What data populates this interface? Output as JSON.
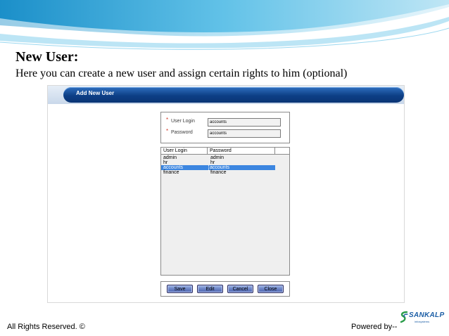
{
  "slide": {
    "title": "New User:",
    "subtitle": "Here you can create a new user and assign certain rights to him (optional)"
  },
  "window": {
    "title": "Add New User"
  },
  "form": {
    "required_mark": "*",
    "user_login_label": "User Login",
    "user_login_value": "accounts",
    "password_label": "Password",
    "password_value": "accounts"
  },
  "user_list": {
    "columns": [
      "User Login",
      "Password"
    ],
    "rows": [
      {
        "login": "admin",
        "password": "admin",
        "selected": false
      },
      {
        "login": "hr",
        "password": "hr",
        "selected": false
      },
      {
        "login": "accounts",
        "password": "accounts",
        "selected": true
      },
      {
        "login": "finance",
        "password": "finance",
        "selected": false
      }
    ],
    "selected_color": "#3c86e0"
  },
  "buttons": {
    "save": "Save",
    "edit": "Edit",
    "cancel": "Cancel",
    "close": "Close"
  },
  "footer": {
    "rights": "All Rights Reserved. ©",
    "powered_by": "Powered by--",
    "logo_text": "SANKALP",
    "logo_tagline": "infosystems"
  },
  "colors": {
    "title_bar": "#0d3f86",
    "swoosh": "#2aa3d6"
  }
}
